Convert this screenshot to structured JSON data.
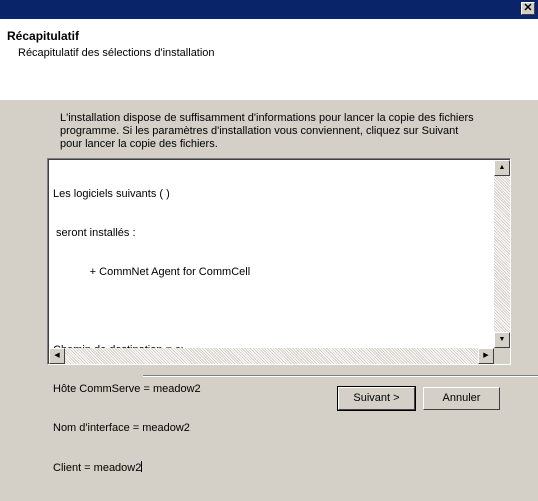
{
  "window": {
    "close_glyph": "✕"
  },
  "header": {
    "title": "Récapitulatif",
    "subtitle": "Récapitulatif des sélections d'installation"
  },
  "intro": {
    "line1": "L'installation dispose de suffisamment d'informations pour lancer la copie des fichiers",
    "line2": "programme. Si les paramètres d'installation vous conviennent, cliquez sur Suivant",
    "line3": "pour lancer la copie des fichiers."
  },
  "summary": {
    "line1": "Les logiciels suivants ( )",
    "line2": " seront installés :",
    "line3": "            + CommNet Agent for CommCell",
    "line4": "",
    "line5": "Chemin de destination = c:",
    "line6": "Hôte CommServe = meadow2",
    "line7": "Nom d'interface = meadow2",
    "line8": "Client = meadow2"
  },
  "buttons": {
    "next_label": "Suivant >",
    "cancel_label": "Annuler"
  }
}
